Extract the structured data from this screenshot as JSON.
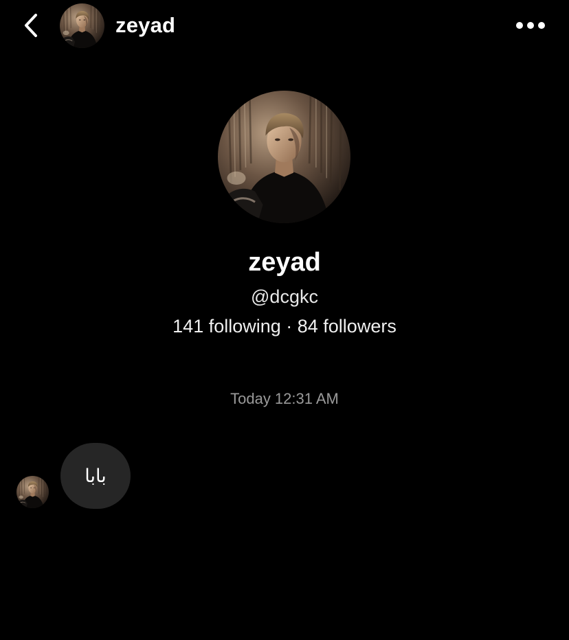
{
  "header": {
    "back_icon": "chevron-left-icon",
    "username": "zeyad",
    "more_icon": "more-horizontal-icon"
  },
  "profile": {
    "name": "zeyad",
    "handle": "@dcgkc",
    "stats": "141 following · 84 followers"
  },
  "conversation": {
    "timestamp": "Today 12:31 AM",
    "messages": [
      {
        "sender": "zeyad",
        "text": "بابا",
        "direction": "incoming"
      }
    ]
  },
  "colors": {
    "background": "#000000",
    "bubble": "#262626",
    "text_primary": "#ffffff",
    "text_secondary": "#9a9a9a"
  }
}
